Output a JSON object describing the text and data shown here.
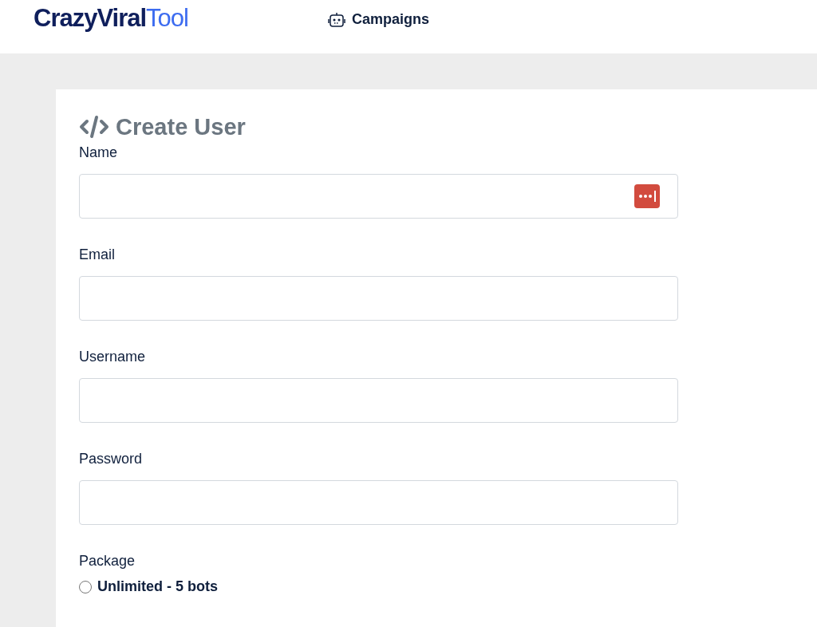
{
  "header": {
    "logo": {
      "primary": "CrazyViral",
      "accent": "Tool"
    },
    "nav": [
      {
        "label": "Campaigns"
      }
    ]
  },
  "form": {
    "title": "Create User",
    "fields": [
      {
        "label": "Name",
        "autofill_icon": true
      },
      {
        "label": "Email",
        "autofill_icon": false
      },
      {
        "label": "Username",
        "autofill_icon": false
      },
      {
        "label": "Password",
        "autofill_icon": false
      }
    ],
    "package": {
      "label": "Package",
      "options": [
        {
          "label": "Unlimited - 5 bots",
          "selected": false
        }
      ]
    }
  }
}
